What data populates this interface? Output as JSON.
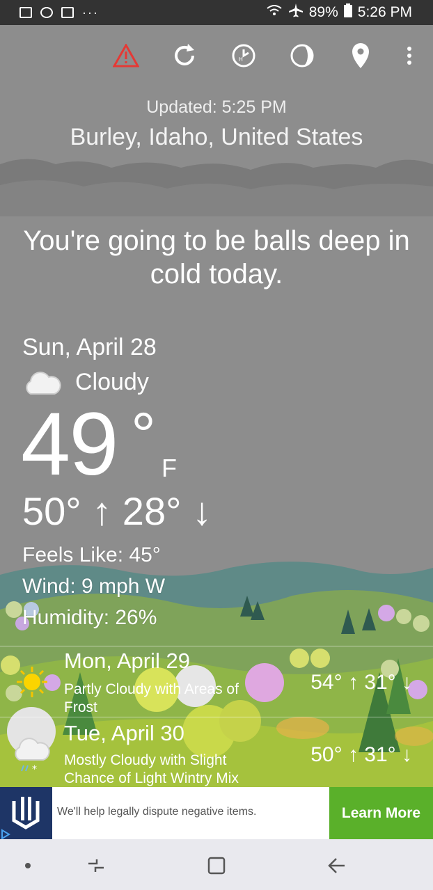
{
  "status_bar": {
    "battery": "89%",
    "time": "5:26 PM",
    "dots": "···"
  },
  "toolbar": {
    "icons": [
      "alert-icon",
      "refresh-icon",
      "history-icon",
      "moon-phase-icon",
      "location-pin-icon",
      "more-vert-icon"
    ],
    "alert_color": "#e53935"
  },
  "header": {
    "updated": "Updated: 5:25 PM",
    "location": "Burley, Idaho, United States"
  },
  "headline": "You're going to be balls deep in cold today.",
  "current": {
    "date": "Sun, April 28",
    "condition": "Cloudy",
    "temperature": "49",
    "degree_symbol": "°",
    "unit": "F",
    "hi_lo": "50° ↑ 28° ↓",
    "feels_like": "Feels Like: 45°",
    "wind": "Wind: 9 mph W",
    "humidity": "Humidity: 26%"
  },
  "forecast": [
    {
      "date": "Mon, April 29",
      "desc": "Partly Cloudy with Areas of Frost",
      "temps": "54° ↑ 31° ↓",
      "icon": "partly-sunny-icon"
    },
    {
      "date": "Tue, April 30",
      "desc": "Mostly Cloudy with Slight Chance of Light Wintry Mix",
      "temps": "50° ↑ 31° ↓",
      "icon": "wintry-mix-icon"
    }
  ],
  "ad": {
    "text": "We'll help legally dispute negative items.",
    "button": "Learn More",
    "button_color": "#5ab02a"
  }
}
